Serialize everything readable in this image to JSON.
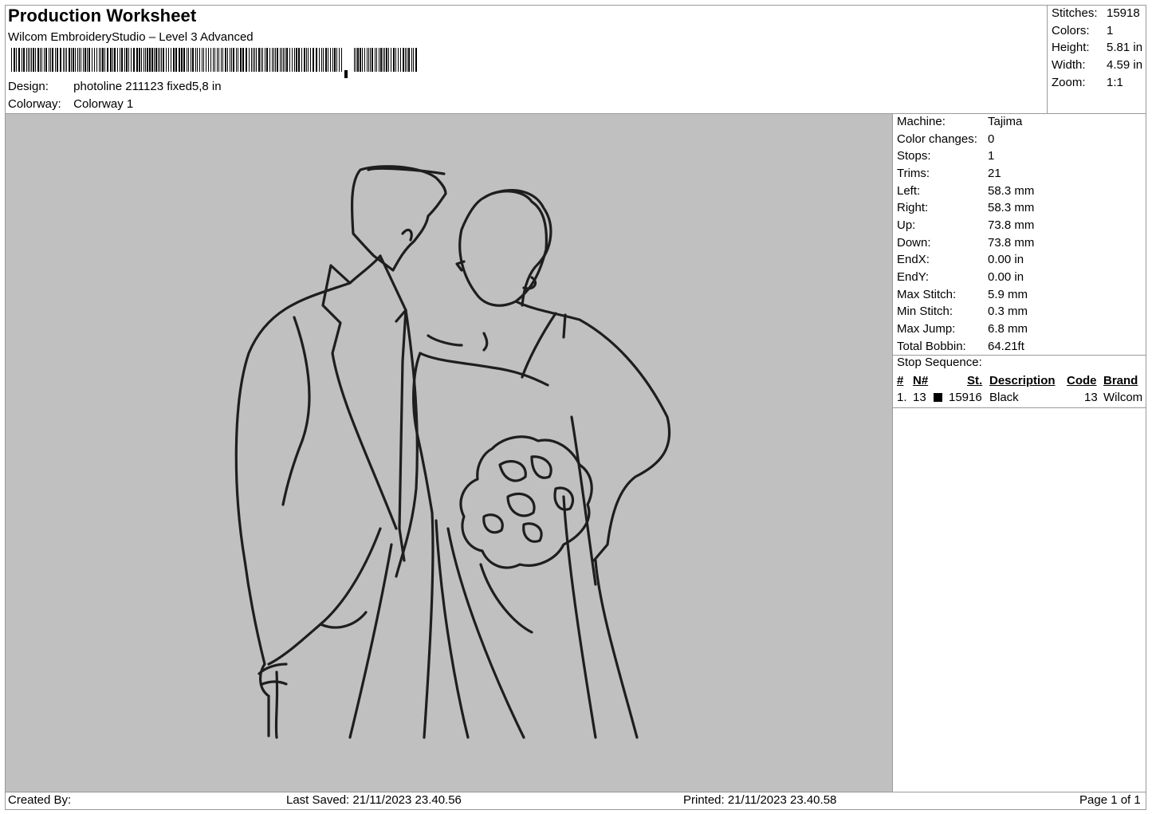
{
  "header": {
    "title": "Production Worksheet",
    "software": "Wilcom EmbroideryStudio – Level 3 Advanced",
    "design_label": "Design:",
    "design_value": "photoline 211123 fixed5,8 in",
    "colorway_label": "Colorway:",
    "colorway_value": "Colorway 1"
  },
  "stats": {
    "stitches_label": "Stitches:",
    "stitches": "15918",
    "colors_label": "Colors:",
    "colors": "1",
    "height_label": "Height:",
    "height": "5.81 in",
    "width_label": "Width:",
    "width": "4.59 in",
    "zoom_label": "Zoom:",
    "zoom": "1:1"
  },
  "machine_info": {
    "machine_label": "Machine:",
    "machine": "Tajima",
    "color_changes_label": "Color changes:",
    "color_changes": "0",
    "stops_label": "Stops:",
    "stops": "1",
    "trims_label": "Trims:",
    "trims": "21",
    "left_label": "Left:",
    "left": "58.3 mm",
    "right_label": "Right:",
    "right": "58.3 mm",
    "up_label": "Up:",
    "up": "73.8 mm",
    "down_label": "Down:",
    "down": "73.8 mm",
    "endx_label": "EndX:",
    "endx": "0.00 in",
    "endy_label": "EndY:",
    "endy": "0.00 in",
    "max_stitch_label": "Max Stitch:",
    "max_stitch": "5.9 mm",
    "min_stitch_label": "Min Stitch:",
    "min_stitch": "0.3 mm",
    "max_jump_label": "Max Jump:",
    "max_jump": "6.8 mm",
    "total_bobbin_label": "Total Bobbin:",
    "total_bobbin": "64.21ft"
  },
  "stop_sequence": {
    "title": "Stop Sequence:",
    "columns": {
      "num": "#",
      "n": "N#",
      "st": "St.",
      "description": "Description",
      "code": "Code",
      "brand": "Brand"
    },
    "rows": [
      {
        "num": "1.",
        "n": "13",
        "swatch_color": "#000000",
        "st": "15916",
        "description": "Black",
        "code": "13",
        "brand": "Wilcom"
      }
    ]
  },
  "footer": {
    "created_by": "Created By:",
    "last_saved": "Last Saved: 21/11/2023 23.40.56",
    "printed": "Printed: 21/11/2023 23.40.58",
    "page": "Page 1 of 1"
  },
  "colors": {
    "canvas_bg": "#c0c0c0",
    "thread": "#1e1e1e"
  }
}
